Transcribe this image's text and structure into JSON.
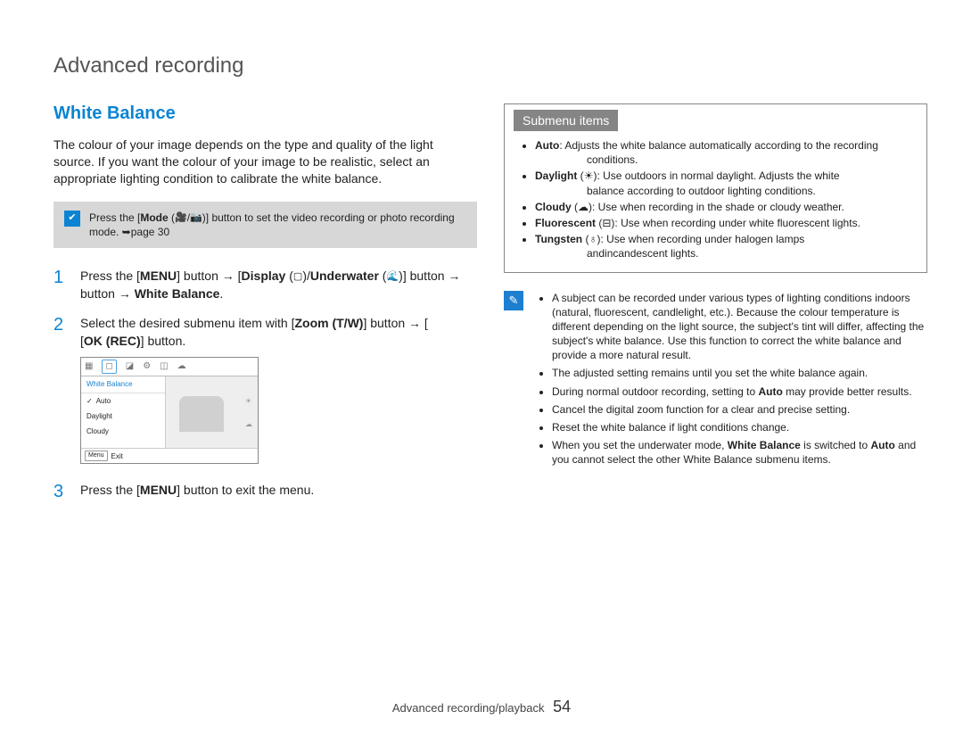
{
  "page_title": "Advanced recording",
  "section_heading": "White Balance",
  "intro_text": "The colour of your image depends on the type and quality of the light source. If you want the colour of your image to be realistic, select an appropriate lighting condition to calibrate the white balance.",
  "mode_note": {
    "prefix": "Press the [",
    "mode_label": "Mode",
    "inline1": " (",
    "inline2": ")] button to set the video recording or photo recording mode. ➥page 30"
  },
  "steps": {
    "s1": {
      "num": "1",
      "t1": "Press the [",
      "menu": "MENU",
      "t2": "] button → [",
      "display": "Display",
      "t3": " (",
      "t3b": ")/",
      "underwater": "Underwater",
      "t4": " (",
      "t4b": ")] button → ",
      "wb": "White Balance",
      "t5": "."
    },
    "s2": {
      "num": "2",
      "t1": "Select the desired submenu item with [",
      "zoom": "Zoom",
      "tw": " (T/W)",
      "t2": "] button → [",
      "ok": "OK (REC)",
      "t3": "] button."
    },
    "s3": {
      "num": "3",
      "t1": "Press the [",
      "menu": "MENU",
      "t2": "] button to exit the menu."
    }
  },
  "menu_shot": {
    "title": "White Balance",
    "items": [
      "Auto",
      "Daylight",
      "Cloudy"
    ],
    "exit_btn": "Menu",
    "exit_label": "Exit"
  },
  "submenu": {
    "header": "Submenu items",
    "items": [
      {
        "name": "Auto",
        "icon": "",
        "text": ": Adjusts the white balance automatically according to the recording",
        "cont": "conditions."
      },
      {
        "name": "Daylight",
        "icon": "☀",
        "text": ": Use outdoors in normal daylight. Adjusts the white",
        "cont": "balance according to outdoor lighting conditions."
      },
      {
        "name": "Cloudy",
        "icon": "☁",
        "text": ": Use when recording in the shade or cloudy weather.",
        "cont": ""
      },
      {
        "name": "Fluorescent",
        "icon": "⊟",
        "text": ": Use when recording under white fluorescent lights.",
        "cont": ""
      },
      {
        "name": "Tungsten",
        "icon": "♁",
        "text": ": Use when recording under halogen lamps",
        "cont": "andincandescent lights."
      }
    ]
  },
  "tips": [
    "A subject can be recorded under various types of lighting conditions indoors (natural, fluorescent, candlelight, etc.). Because the colour temperature is different depending on the light source, the subject's tint will differ, affecting the subject's white balance. Use this function to correct the white balance and provide a more natural result.",
    "The adjusted setting remains until you set the white balance again.",
    "During normal outdoor recording, setting to |Auto| may provide better results.",
    "Cancel the digital zoom function for a clear and precise setting.",
    "Reset the white balance if light conditions change.",
    "When you set the underwater mode, |White Balance| is switched to |Auto| and you cannot select the other White Balance submenu items."
  ],
  "footer": {
    "section": "Advanced recording/playback",
    "page": "54"
  }
}
